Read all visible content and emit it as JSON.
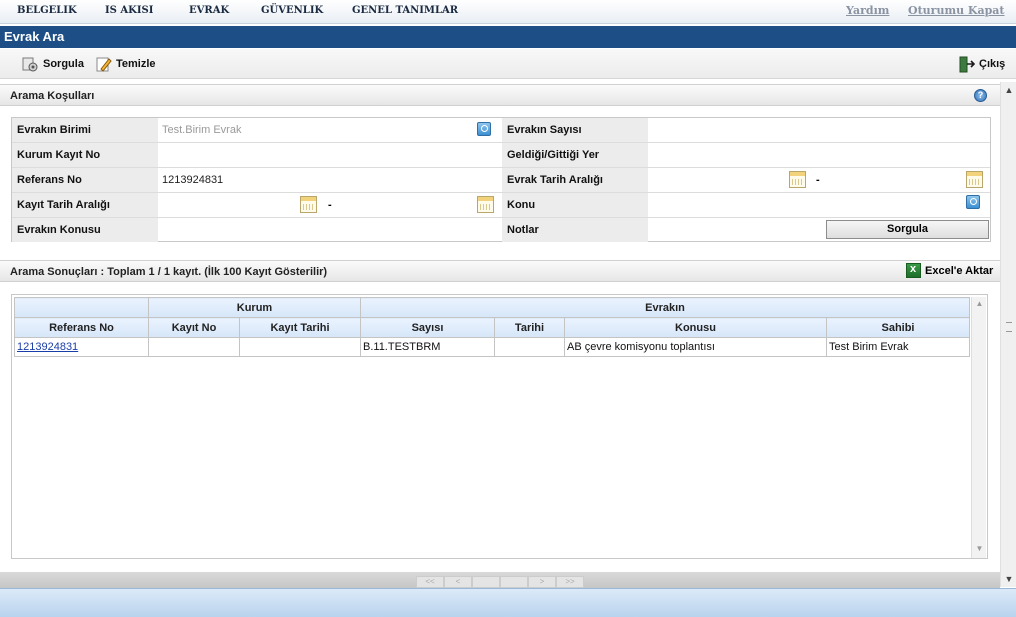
{
  "menu": {
    "items": [
      "BELGELIK",
      "IS AKISI",
      "EVRAK",
      "GÜVENLIK",
      "GENEL TANIMLAR"
    ],
    "help": "Yardım",
    "logout": "Oturumu Kapat"
  },
  "page_title": "Evrak Ara",
  "toolbar": {
    "search": "Sorgula",
    "clear": "Temizle",
    "exit": "Çıkış"
  },
  "criteria": {
    "header": "Arama Koşulları",
    "fields": {
      "evrakin_birimi": {
        "label": "Evrakın Birimi",
        "placeholder": "Test.Birim Evrak"
      },
      "evrakin_sayisi": {
        "label": "Evrakın Sayısı",
        "value": ""
      },
      "kurum_kayit_no": {
        "label": "Kurum Kayıt No",
        "value": ""
      },
      "geldigi_gittigi_yer": {
        "label": "Geldiği/Gittiği Yer",
        "value": ""
      },
      "referans_no": {
        "label": "Referans No",
        "value": "1213924831"
      },
      "evrak_tarih_araligi": {
        "label": "Evrak Tarih Aralığı",
        "separator": "-"
      },
      "kayit_tarih_araligi": {
        "label": "Kayıt Tarih Aralığı",
        "separator": "-"
      },
      "konu": {
        "label": "Konu",
        "value": ""
      },
      "evrakin_konusu": {
        "label": "Evrakın Konusu",
        "value": ""
      },
      "notlar": {
        "label": "Notlar"
      }
    },
    "query_button": "Sorgula"
  },
  "results": {
    "header": "Arama Sonuçları : Toplam 1 / 1 kayıt. (İlk 100 Kayıt Gösterilir)",
    "export": "Excel'e Aktar",
    "group_headers": {
      "kurum": "Kurum",
      "evrakin": "Evrakın"
    },
    "columns": [
      "Referans No",
      "Kayıt No",
      "Kayıt Tarihi",
      "Sayısı",
      "Tarihi",
      "Konusu",
      "Sahibi"
    ],
    "rows": [
      [
        "1213924831",
        "",
        "",
        "B.11.TESTBRM",
        "",
        "AB çevre komisyonu toplantısı",
        "Test Birim Evrak"
      ]
    ]
  },
  "pager": [
    "<<",
    "<",
    "",
    "",
    ">",
    ">>"
  ]
}
